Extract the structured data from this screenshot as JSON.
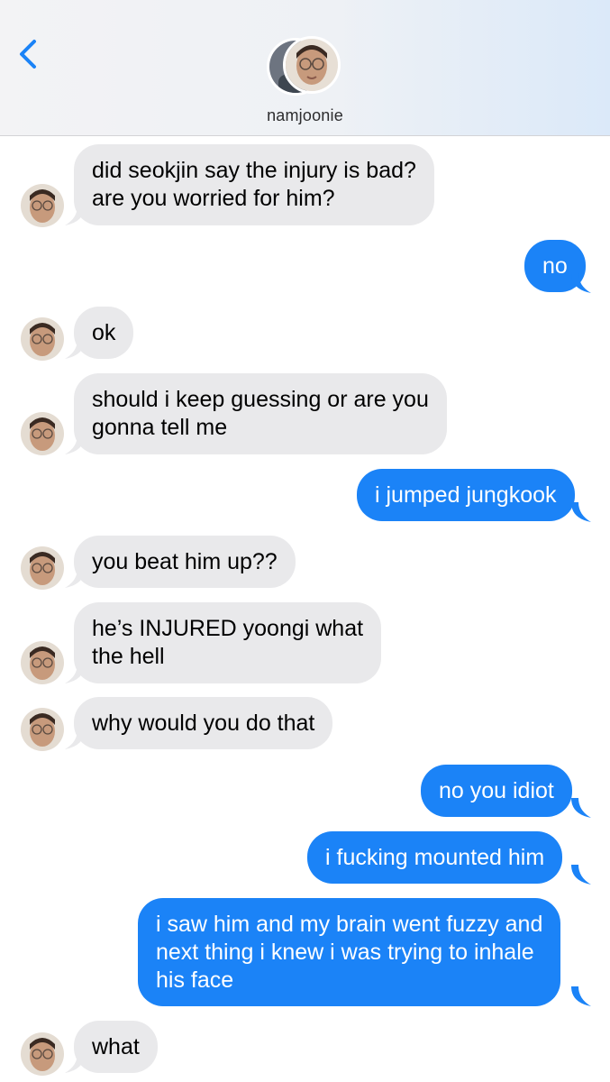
{
  "header": {
    "contact_name": "namjoonie",
    "back_icon": "chevron-left-icon"
  },
  "colors": {
    "incoming_bubble": "#e9e9eb",
    "outgoing_bubble": "#1b83f7",
    "accent": "#1b83f7"
  },
  "messages": [
    {
      "from": "them",
      "lines": [
        "did seokjin say the injury is bad?",
        "are you worried for him?"
      ]
    },
    {
      "from": "me",
      "lines": [
        "no"
      ]
    },
    {
      "from": "them",
      "lines": [
        "ok"
      ]
    },
    {
      "from": "them",
      "lines": [
        "should i keep guessing or are you",
        "gonna tell me"
      ]
    },
    {
      "from": "me",
      "lines": [
        "i jumped jungkook"
      ]
    },
    {
      "from": "them",
      "lines": [
        "you beat him up??"
      ]
    },
    {
      "from": "them",
      "lines": [
        "he’s INJURED yoongi what",
        "the hell"
      ]
    },
    {
      "from": "them",
      "lines": [
        "why would you do that"
      ]
    },
    {
      "from": "me",
      "lines": [
        "no you idiot"
      ]
    },
    {
      "from": "me",
      "lines": [
        "i fucking mounted him"
      ]
    },
    {
      "from": "me",
      "lines": [
        "i saw him and my brain went fuzzy and",
        "next thing i knew i was trying to inhale",
        "his face"
      ]
    },
    {
      "from": "them",
      "lines": [
        "what"
      ]
    }
  ]
}
